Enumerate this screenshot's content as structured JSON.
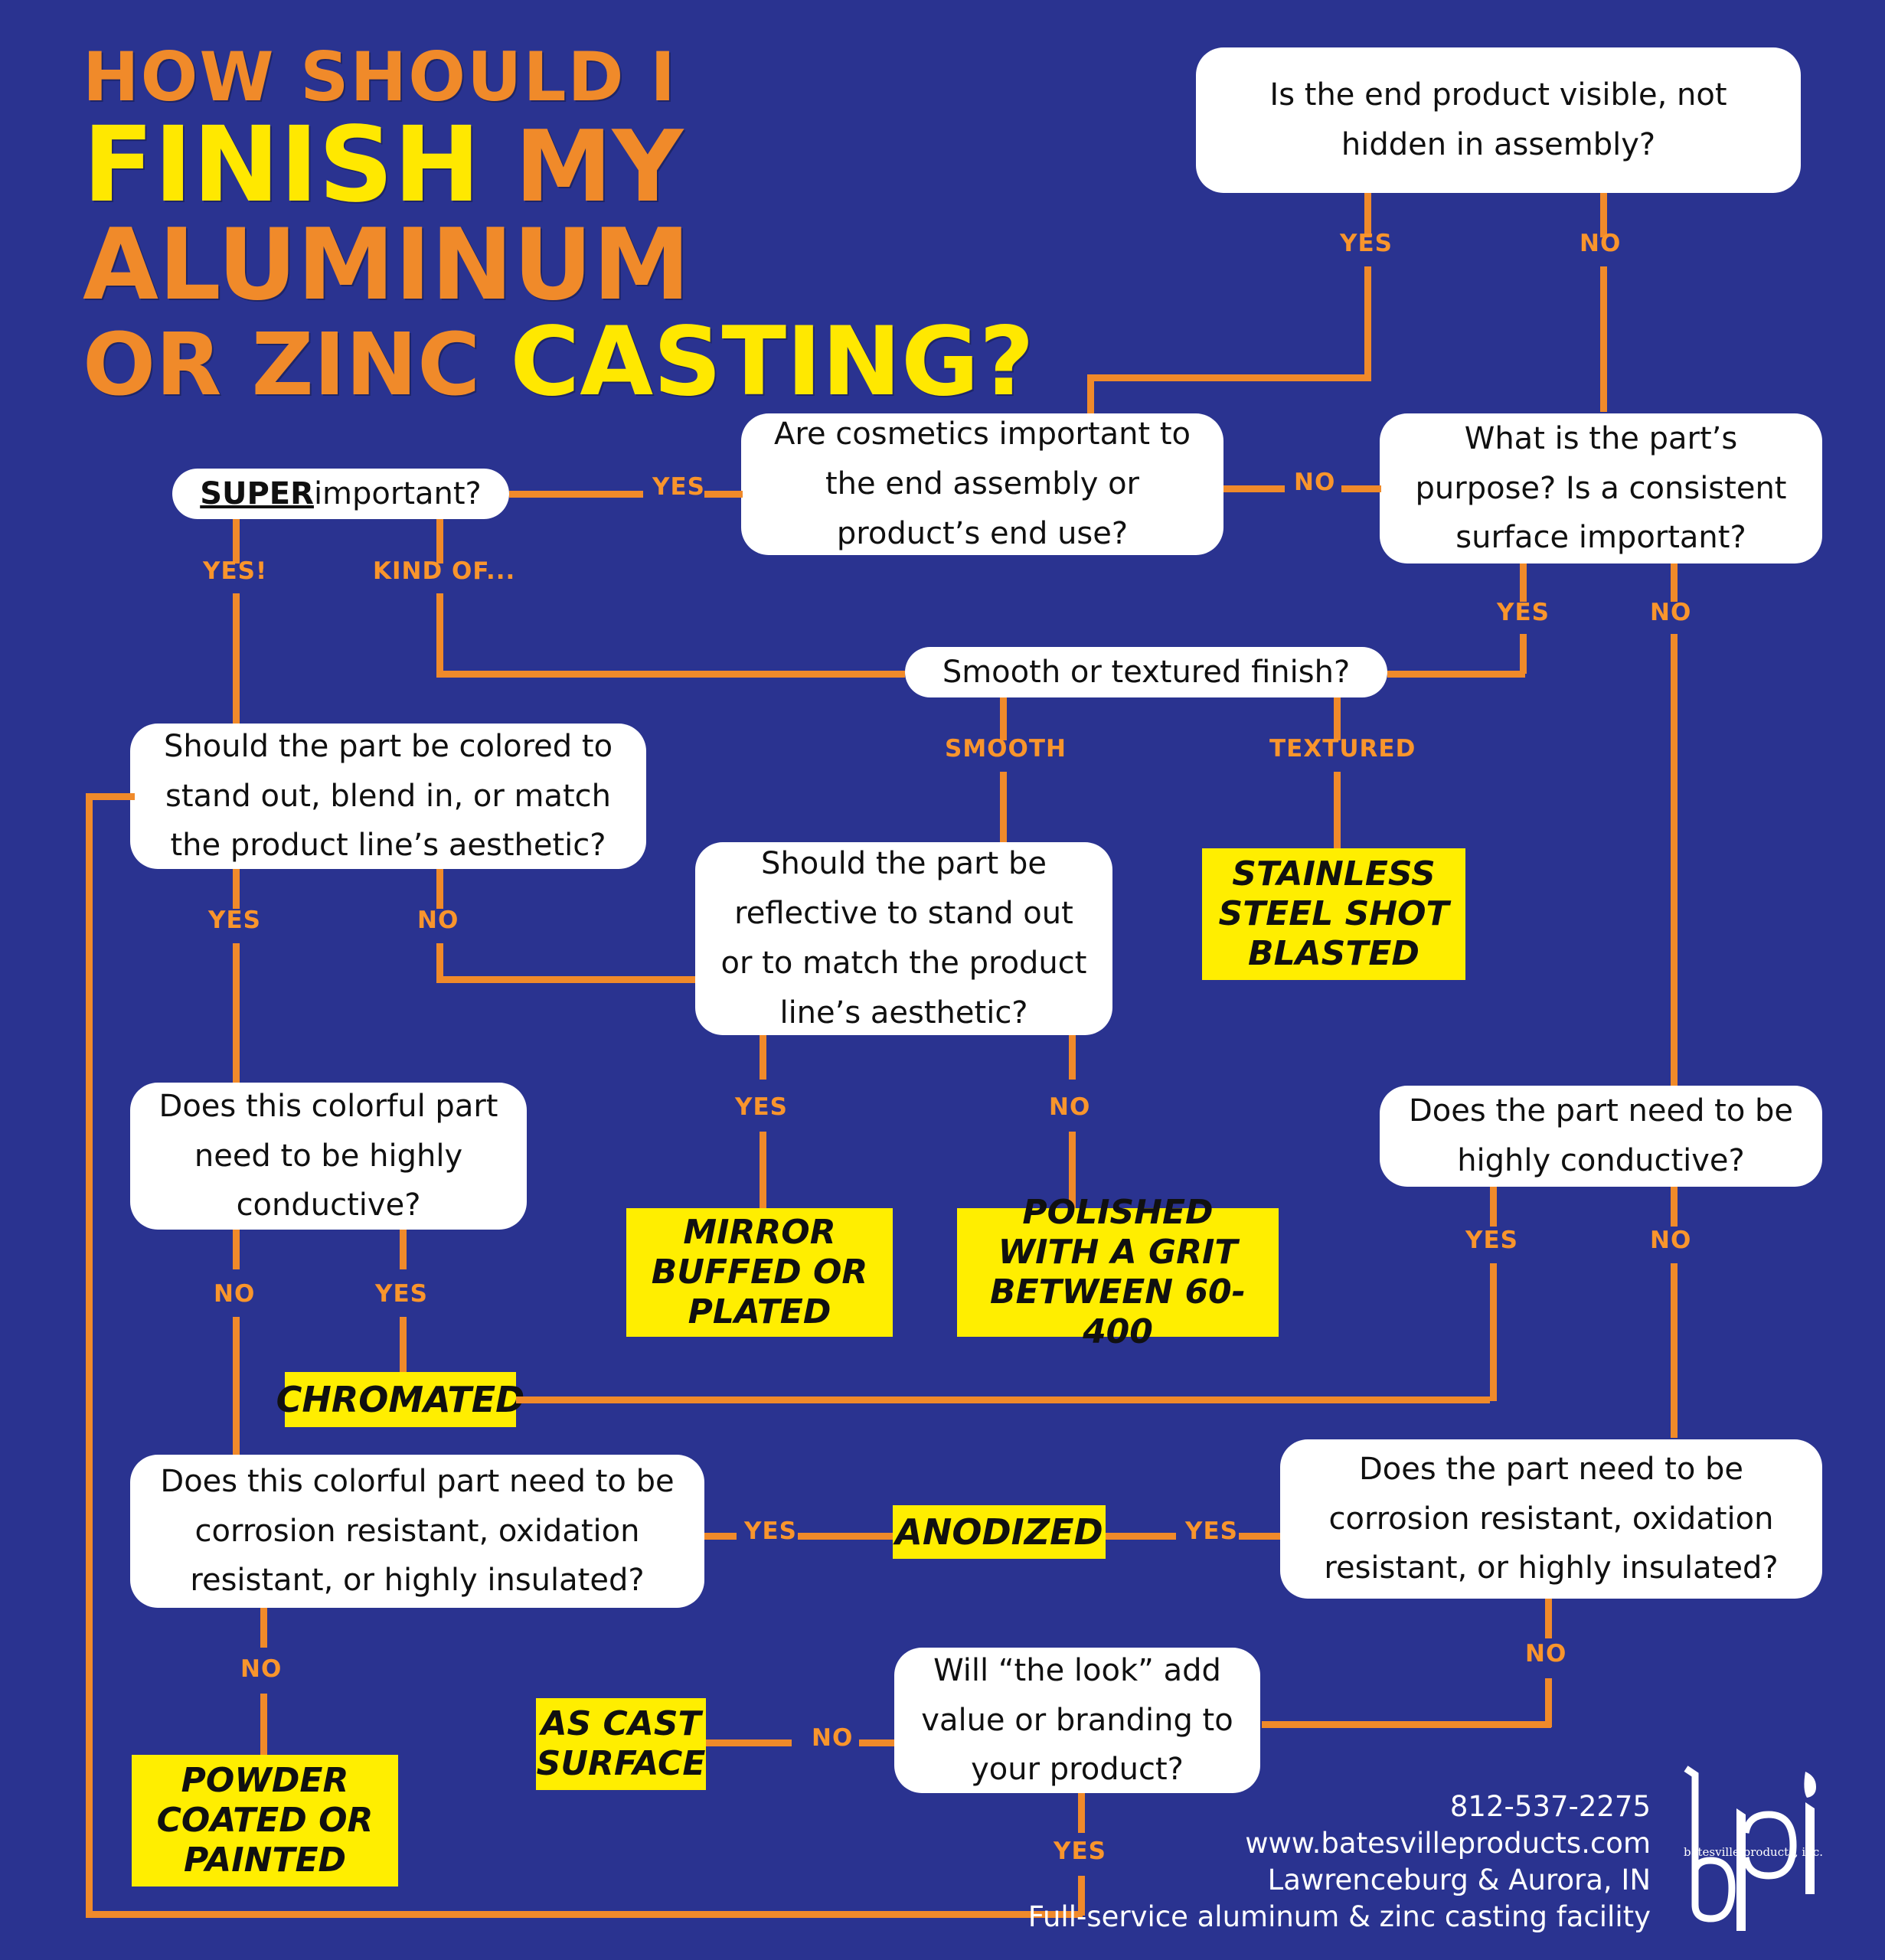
{
  "colors": {
    "background": "#2a3390",
    "orange": "#f08a2a",
    "yellow": "#ffee00",
    "white": "#ffffff",
    "title_yellow": "#ffe800"
  },
  "title": {
    "line1": "HOW SHOULD I",
    "line2_yellow": "FINISH",
    "line2_orange": "MY ALUMINUM",
    "line3_orange": "OR ZINC",
    "line3_yellow": "CASTING?"
  },
  "questions": {
    "q_visible": "Is the end product visible, not hidden in assembly?",
    "q_cosmetics": "Are cosmetics important to the end assembly or product’s end use?",
    "q_purpose": "What is the part’s purpose? Is a consistent surface important?",
    "q_super_prefix": "SUPER",
    "q_super_suffix": " important?",
    "q_finish": "Smooth or textured finish?",
    "q_colored": "Should the part be colored to stand out, blend in, or match the product line’s aesthetic?",
    "q_reflective": "Should the part be reflective to stand out or to match the product line’s aesthetic?",
    "q_colorful_conductive": "Does this colorful part need to be highly conductive?",
    "q_part_conductive": "Does the part need to be highly conductive?",
    "q_colorful_corrosion": "Does this colorful part need to be corrosion resistant, oxidation resistant, or highly insulated?",
    "q_part_corrosion": "Does the part need to be corrosion resistant, oxidation resistant, or highly insulated?",
    "q_look": "Will “the look” add value or branding to your product?"
  },
  "answers": {
    "a_shot_blasted": "STAINLESS STEEL SHOT BLASTED",
    "a_mirror": "MIRROR BUFFED OR PLATED",
    "a_polished": "POLISHED WITH A GRIT BETWEEN 60-400",
    "a_chromated": "CHROMATED",
    "a_anodized": "ANODIZED",
    "a_as_cast": "AS CAST SURFACE",
    "a_powder": "POWDER COATED OR PAINTED"
  },
  "edge_labels": {
    "visible_yes": "YES",
    "visible_no": "NO",
    "cosmetics_yes": "YES",
    "cosmetics_no": "NO",
    "super_yes": "YES!",
    "super_kind_of": "KIND OF...",
    "purpose_yes": "YES",
    "purpose_no": "NO",
    "finish_smooth": "SMOOTH",
    "finish_textured": "TEXTURED",
    "colored_yes": "YES",
    "colored_no": "NO",
    "reflective_yes": "YES",
    "reflective_no": "NO",
    "colorful_cond_no": "NO",
    "colorful_cond_yes": "YES",
    "part_cond_yes": "YES",
    "part_cond_no": "NO",
    "colorful_corr_yes": "YES",
    "colorful_corr_no": "NO",
    "part_corr_yes": "YES",
    "part_corr_no": "NO",
    "look_no": "NO",
    "look_yes": "YES"
  },
  "footer": {
    "phone": "812-537-2275",
    "website": "www.batesvilleproducts.com",
    "location": "Lawrenceburg & Aurora, IN",
    "tagline": "Full-service aluminum & zinc casting facility",
    "logo_text": "batesville products, inc."
  }
}
